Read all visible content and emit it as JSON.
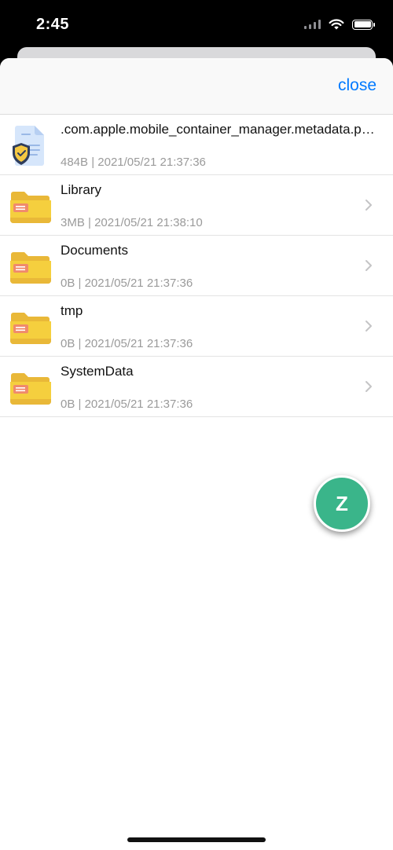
{
  "status_bar": {
    "time": "2:45"
  },
  "navbar": {
    "close_label": "close"
  },
  "files": [
    {
      "name": ".com.apple.mobile_container_manager.metadata.plist",
      "meta": "484B | 2021/05/21 21:37:36",
      "type": "file-secure",
      "has_chevron": false
    },
    {
      "name": "Library",
      "meta": "3MB | 2021/05/21 21:38:10",
      "type": "folder",
      "has_chevron": true
    },
    {
      "name": "Documents",
      "meta": "0B | 2021/05/21 21:37:36",
      "type": "folder",
      "has_chevron": true
    },
    {
      "name": "tmp",
      "meta": "0B | 2021/05/21 21:37:36",
      "type": "folder",
      "has_chevron": true
    },
    {
      "name": "SystemData",
      "meta": "0B | 2021/05/21 21:37:36",
      "type": "folder",
      "has_chevron": true
    }
  ],
  "fab": {
    "label": "Z",
    "color": "#3ab58a"
  },
  "colors": {
    "accent": "#007aff",
    "folder": "#f5cf3e",
    "meta_text": "#9a9a9a"
  }
}
